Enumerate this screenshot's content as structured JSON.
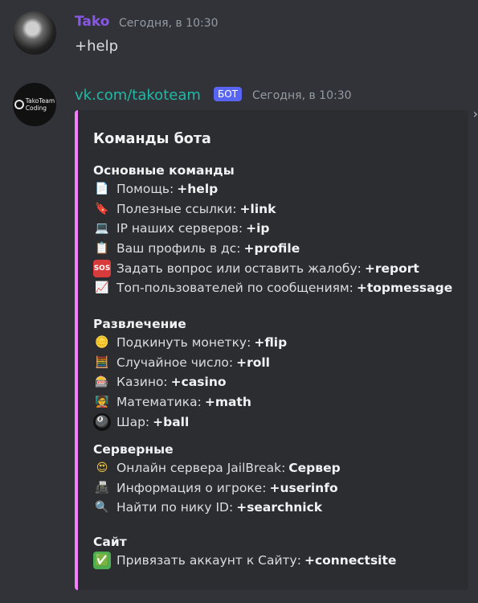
{
  "messages": [
    {
      "author": "Tako",
      "timestamp": "Сегодня, в 10:30",
      "content": "+help"
    },
    {
      "author": "vk.com/takoteam",
      "bot_tag": "БОТ",
      "timestamp": "Сегодня, в 10:30",
      "avatar_text": [
        "TakoTeam",
        "Coding"
      ],
      "embed": {
        "title": "Команды бота",
        "close_glyph": "›",
        "sections": [
          {
            "title": "Основные команды",
            "lines": [
              {
                "icon": "document-icon",
                "glyph": "📄",
                "text": "Помощь:",
                "cmd": "+help"
              },
              {
                "icon": "bookmark-icon",
                "glyph": "🔖",
                "text": "Полезные ссылки:",
                "cmd": "+link"
              },
              {
                "icon": "laptop-icon",
                "glyph": "💻",
                "text": "IP наших серверов:",
                "cmd": "+ip"
              },
              {
                "icon": "clipboard-icon",
                "glyph": "📋",
                "text": "Ваш профиль в дс:",
                "cmd": "+profile"
              },
              {
                "icon": "sos-icon",
                "glyph": "SOS",
                "text": "Задать вопрос или оставить жалобу:",
                "cmd": "+report"
              },
              {
                "icon": "chart-up-icon",
                "glyph": "📈",
                "text": "Топ-пользователей по сообщениям:",
                "cmd": "+topmessage"
              }
            ]
          },
          {
            "title": "Развлечение",
            "lines": [
              {
                "icon": "coin-icon",
                "glyph": "🪙",
                "text": "Подкинуть монетку:",
                "cmd": "+flip"
              },
              {
                "icon": "abacus-icon",
                "glyph": "🧮",
                "text": "Случайное число:",
                "cmd": "+roll"
              },
              {
                "icon": "slot-machine-icon",
                "glyph": "🎰",
                "text": "Казино:",
                "cmd": "+casino"
              },
              {
                "icon": "teacher-icon",
                "glyph": "🧑‍🏫",
                "text": "Математика:",
                "cmd": "+math"
              },
              {
                "icon": "8-ball-icon",
                "glyph": "🎱",
                "text": "Шар:",
                "cmd": "+ball"
              }
            ]
          },
          {
            "title": "Серверные",
            "lines": [
              {
                "icon": "heart-eyes-icon",
                "glyph": "😍",
                "text": "Онлайн сервера JailBreak:",
                "cmd": "Сервер"
              },
              {
                "icon": "fax-icon",
                "glyph": "📠",
                "text": "Информация о игроке:",
                "cmd": "+userinfo"
              },
              {
                "icon": "magnifier-icon",
                "glyph": "🔍",
                "text": "Найти по нику ID:",
                "cmd": "+searchnick"
              }
            ]
          },
          {
            "title": "Сайт",
            "lines": [
              {
                "icon": "check-mark-icon",
                "glyph": "✅",
                "text": "Привязать аккаунт к Сайту:",
                "cmd": "+connectsite"
              }
            ]
          }
        ]
      }
    }
  ],
  "colors": {
    "background": "#313338",
    "embed_background": "#2b2d31",
    "embed_accent": "#f47fff",
    "bot_tag": "#5865f2",
    "author_tako": "#8957e5",
    "author_bot": "#20b9a5"
  }
}
